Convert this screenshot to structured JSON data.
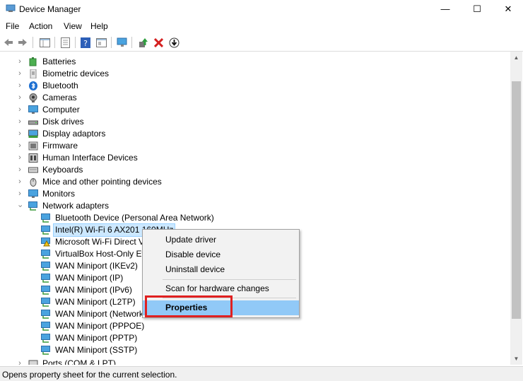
{
  "window": {
    "title": "Device Manager",
    "controls": {
      "minimize": "—",
      "maximize": "☐",
      "close": "✕"
    }
  },
  "menu": [
    "File",
    "Action",
    "View",
    "Help"
  ],
  "tree": {
    "categories": [
      {
        "label": "Batteries",
        "icon": "battery-icon"
      },
      {
        "label": "Biometric devices",
        "icon": "biometric-icon"
      },
      {
        "label": "Bluetooth",
        "icon": "bluetooth-icon"
      },
      {
        "label": "Cameras",
        "icon": "camera-icon"
      },
      {
        "label": "Computer",
        "icon": "computer-icon"
      },
      {
        "label": "Disk drives",
        "icon": "disk-icon"
      },
      {
        "label": "Display adaptors",
        "icon": "display-icon"
      },
      {
        "label": "Firmware",
        "icon": "firmware-icon"
      },
      {
        "label": "Human Interface Devices",
        "icon": "hid-icon"
      },
      {
        "label": "Keyboards",
        "icon": "keyboard-icon"
      },
      {
        "label": "Mice and other pointing devices",
        "icon": "mouse-icon"
      },
      {
        "label": "Monitors",
        "icon": "monitor-icon"
      },
      {
        "label": "Network adapters",
        "icon": "network-icon"
      }
    ],
    "network_children": [
      "Bluetooth Device (Personal Area Network)",
      "Intel(R) Wi-Fi 6 AX201 160MHz",
      "Microsoft Wi-Fi Direct Vi",
      "VirtualBox Host-Only Eth",
      "WAN Miniport (IKEv2)",
      "WAN Miniport (IP)",
      "WAN Miniport (IPv6)",
      "WAN Miniport (L2TP)",
      "WAN Miniport (Network",
      "WAN Miniport (PPPOE)",
      "WAN Miniport (PPTP)",
      "WAN Miniport (SSTP)"
    ],
    "last_category": "Ports (COM & LPT)"
  },
  "context_menu": {
    "update": "Update driver",
    "disable": "Disable device",
    "uninstall": "Uninstall device",
    "scan": "Scan for hardware changes",
    "properties": "Properties"
  },
  "status": "Opens property sheet for the current selection.",
  "colors": {
    "highlight": "#91c9f7",
    "annotation_box": "#e02020",
    "selection": "#cce8ff"
  }
}
